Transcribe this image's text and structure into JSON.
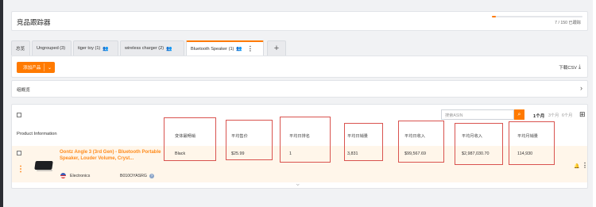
{
  "header": {
    "title": "竞品跟踪器",
    "progress_text": "7 / 150 已跟踪",
    "progress_fraction": 0.047
  },
  "tabs": [
    {
      "label": "总览"
    },
    {
      "label": "Ungrouped (3)"
    },
    {
      "label": "tiger toy (1)"
    },
    {
      "label": "wireless charger (2)"
    },
    {
      "label": "Bluetooth Speaker (1)"
    }
  ],
  "toolbar": {
    "add_product_label": "添加产品",
    "download_csv_label": "下载CSV"
  },
  "summary": {
    "label": "组概览"
  },
  "search": {
    "placeholder": "搜索ASIN"
  },
  "period": {
    "active": "1个月",
    "options": [
      "3个月",
      "6个月"
    ]
  },
  "table": {
    "product_header": "Product Information",
    "columns": [
      "变体最畅销",
      "平均售价",
      "平均日排名",
      "平均日销量",
      "平均日收入",
      "平均月收入",
      "平均月销量"
    ],
    "row": {
      "title": "Oontz Angle 3 (3rd Gen) - Bluetooth Portable Speaker, Louder Volume, Cryst...",
      "category": "Electronics",
      "asin": "B010OYASRG",
      "values": [
        "Black",
        "$25.99",
        "1",
        "3,831",
        "$99,567.69",
        "$2,987,030.70",
        "114,930"
      ]
    }
  },
  "colors": {
    "accent": "#ff7a00",
    "highlight_box": "#d9534f",
    "row_bg": "#fff6ea"
  }
}
